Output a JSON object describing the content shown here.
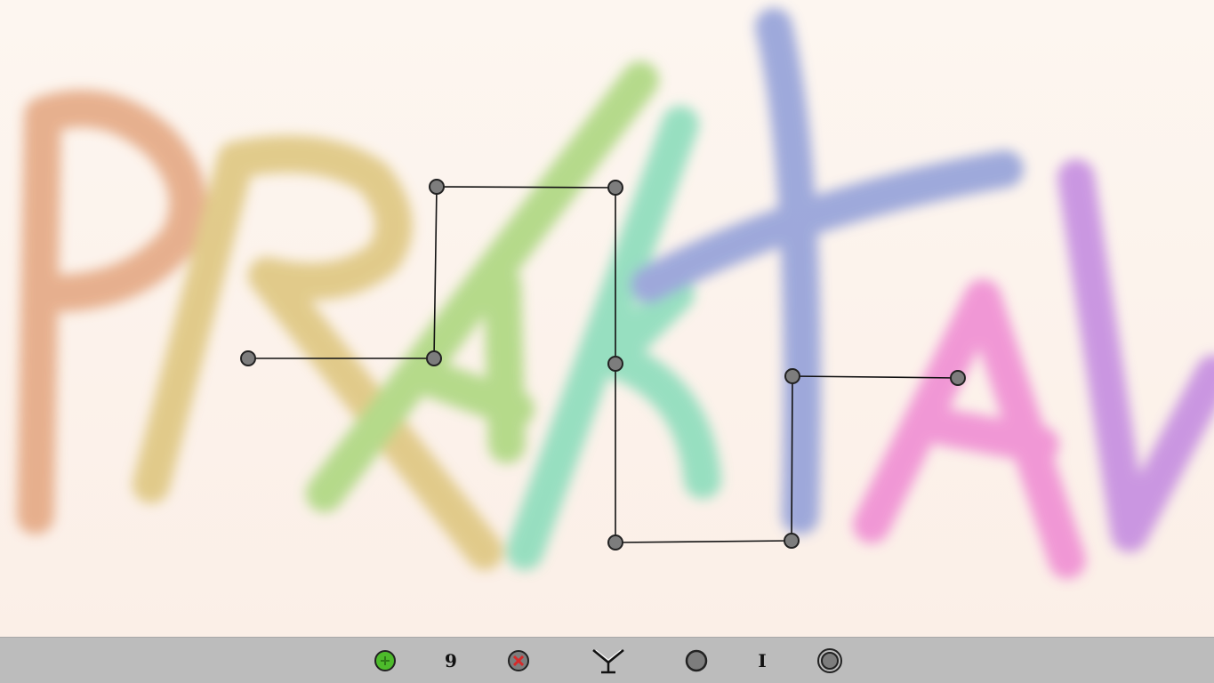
{
  "game": {
    "background_word": "PRAKTAV",
    "letter_colors": [
      "#e3a47e",
      "#ddc47a",
      "#a9d67a",
      "#86dcb9",
      "#8e9cd8",
      "#ef88d2",
      "#c287e0"
    ],
    "node_fill": "#7d7d7d",
    "edge_color": "#111111"
  },
  "toolbar": {
    "add_label": "add",
    "counter": "9",
    "remove_label": "remove",
    "tool_label": "Y",
    "node_tool_label": "node",
    "level": "I",
    "target_label": "target"
  },
  "colors": {
    "toolbar_bg": "#bcbcbc",
    "add_green": "#4dbb2b",
    "remove_red": "#d62a2a"
  }
}
